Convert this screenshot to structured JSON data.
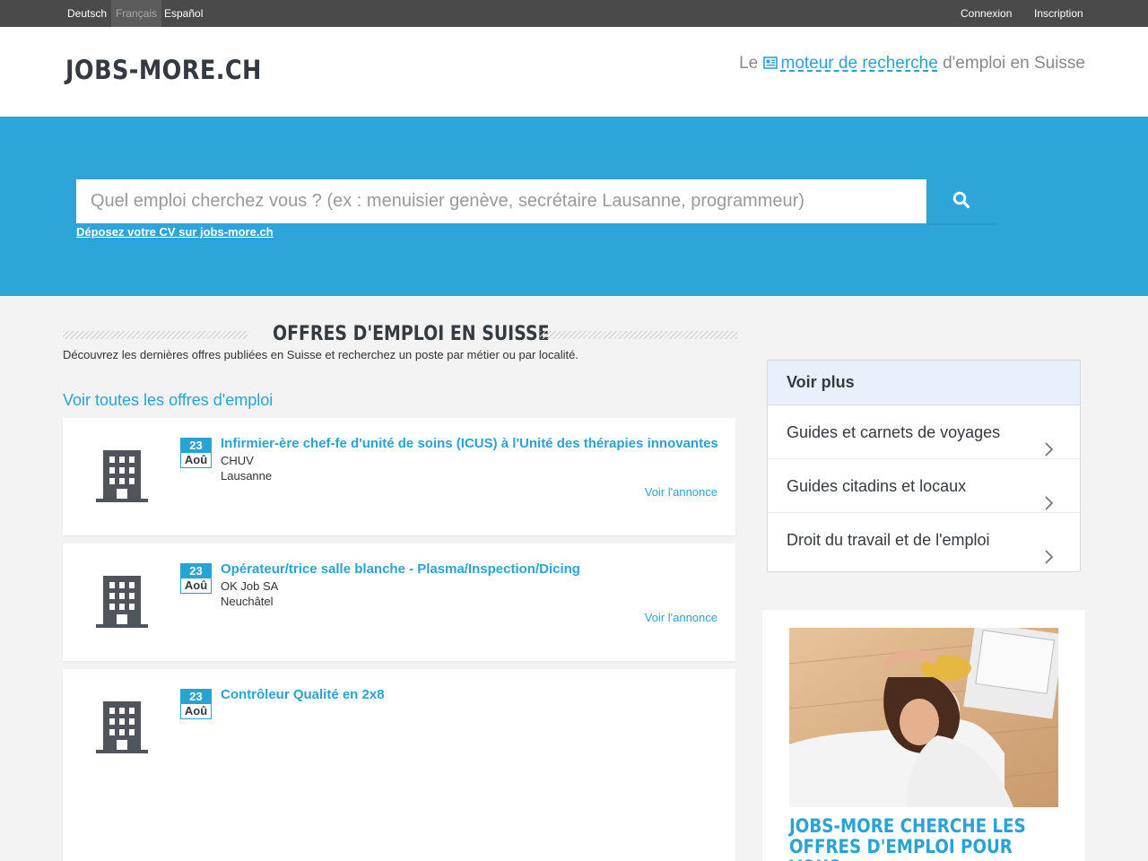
{
  "topbar": {
    "languages": [
      "Deutsch",
      "Français",
      "Español"
    ],
    "active_language": "Français",
    "login": "Connexion",
    "signup": "Inscription"
  },
  "header": {
    "logo": "JOBS-MORE.CH",
    "tagline_prefix": "Le",
    "tagline_link": "moteur de recherche",
    "tagline_suffix": "d'emploi en Suisse"
  },
  "search": {
    "placeholder": "Quel emploi cherchez vous ? (ex : menuisier genève, secrétaire Lausanne, programmeur)",
    "cv_link": "Déposez votre CV sur jobs-more.ch"
  },
  "main": {
    "section_title": "OFFRES D'EMPLOI EN SUISSE",
    "description": "Découvrez les dernières offres publiées en Suisse et recherchez un poste par métier ou par localité.",
    "all_offers_link": "Voir toutes les offres d'emploi",
    "jobs": [
      {
        "day": "23",
        "month": "Aoû",
        "title": "Infirmier-ère chef-fe d'unité de soins (ICUS) à l'Unité des thérapies innovantes",
        "company": "CHUV",
        "location": "Lausanne",
        "link": "Voir l'annonce"
      },
      {
        "day": "23",
        "month": "Aoû",
        "title": "Opérateur/trice salle blanche - Plasma/Inspection/Dicing",
        "company": "OK Job SA",
        "location": "Neuchâtel",
        "link": "Voir l'annonce"
      },
      {
        "day": "23",
        "month": "Aoû",
        "title": "Contrôleur Qualité en 2x8",
        "company": "",
        "location": "",
        "link": ""
      }
    ]
  },
  "sidebar": {
    "header": "Voir plus",
    "items": [
      "Guides et carnets de voyages",
      "Guides citadins et locaux",
      "Droit du travail et de l'emploi"
    ]
  },
  "promo": {
    "title": "JOBS-MORE CHERCHE LES OFFRES D'EMPLOI POUR VOUS"
  },
  "colors": {
    "accent": "#29a3d6",
    "hero": "#2ea5d9",
    "topbar": "#4a4a4a",
    "dark_text": "#353a40"
  }
}
